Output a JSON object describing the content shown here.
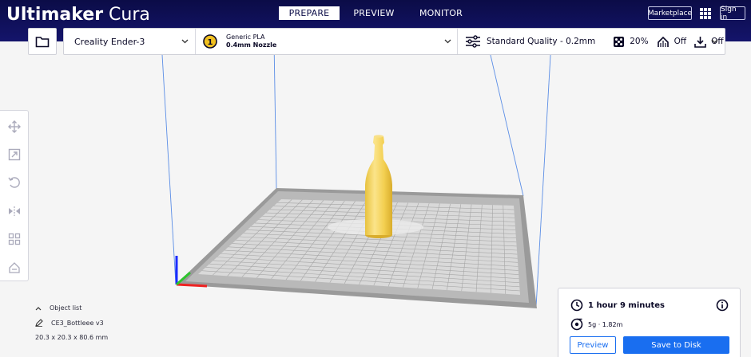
{
  "app": {
    "brand_bold": "Ultimaker",
    "brand_light": " Cura"
  },
  "header": {
    "tabs": [
      {
        "label": "PREPARE",
        "active": true
      },
      {
        "label": "PREVIEW",
        "active": false
      },
      {
        "label": "MONITOR",
        "active": false
      }
    ],
    "marketplace_label": "Marketplace",
    "signin_label": "Sign in"
  },
  "toolbar": {
    "printer": "Creality Ender-3",
    "material_badge": "1",
    "material_name": "Generic PLA",
    "nozzle": "0.4mm Nozzle",
    "quality": "Standard Quality - 0.2mm",
    "infill": "20%",
    "support": "Off",
    "adhesion": "Off"
  },
  "objects": {
    "header": "Object list",
    "name": "CE3_Bottleee v3",
    "dimensions": "20.3 x 20.3 x 80.6 mm"
  },
  "print": {
    "time": "1 hour 9 minutes",
    "material": "5g · 1.82m",
    "preview_label": "Preview",
    "save_label": "Save to Disk"
  },
  "colors": {
    "header_bg": "#0b0c47",
    "accent": "#196ef0",
    "model": "#f6d75a"
  }
}
